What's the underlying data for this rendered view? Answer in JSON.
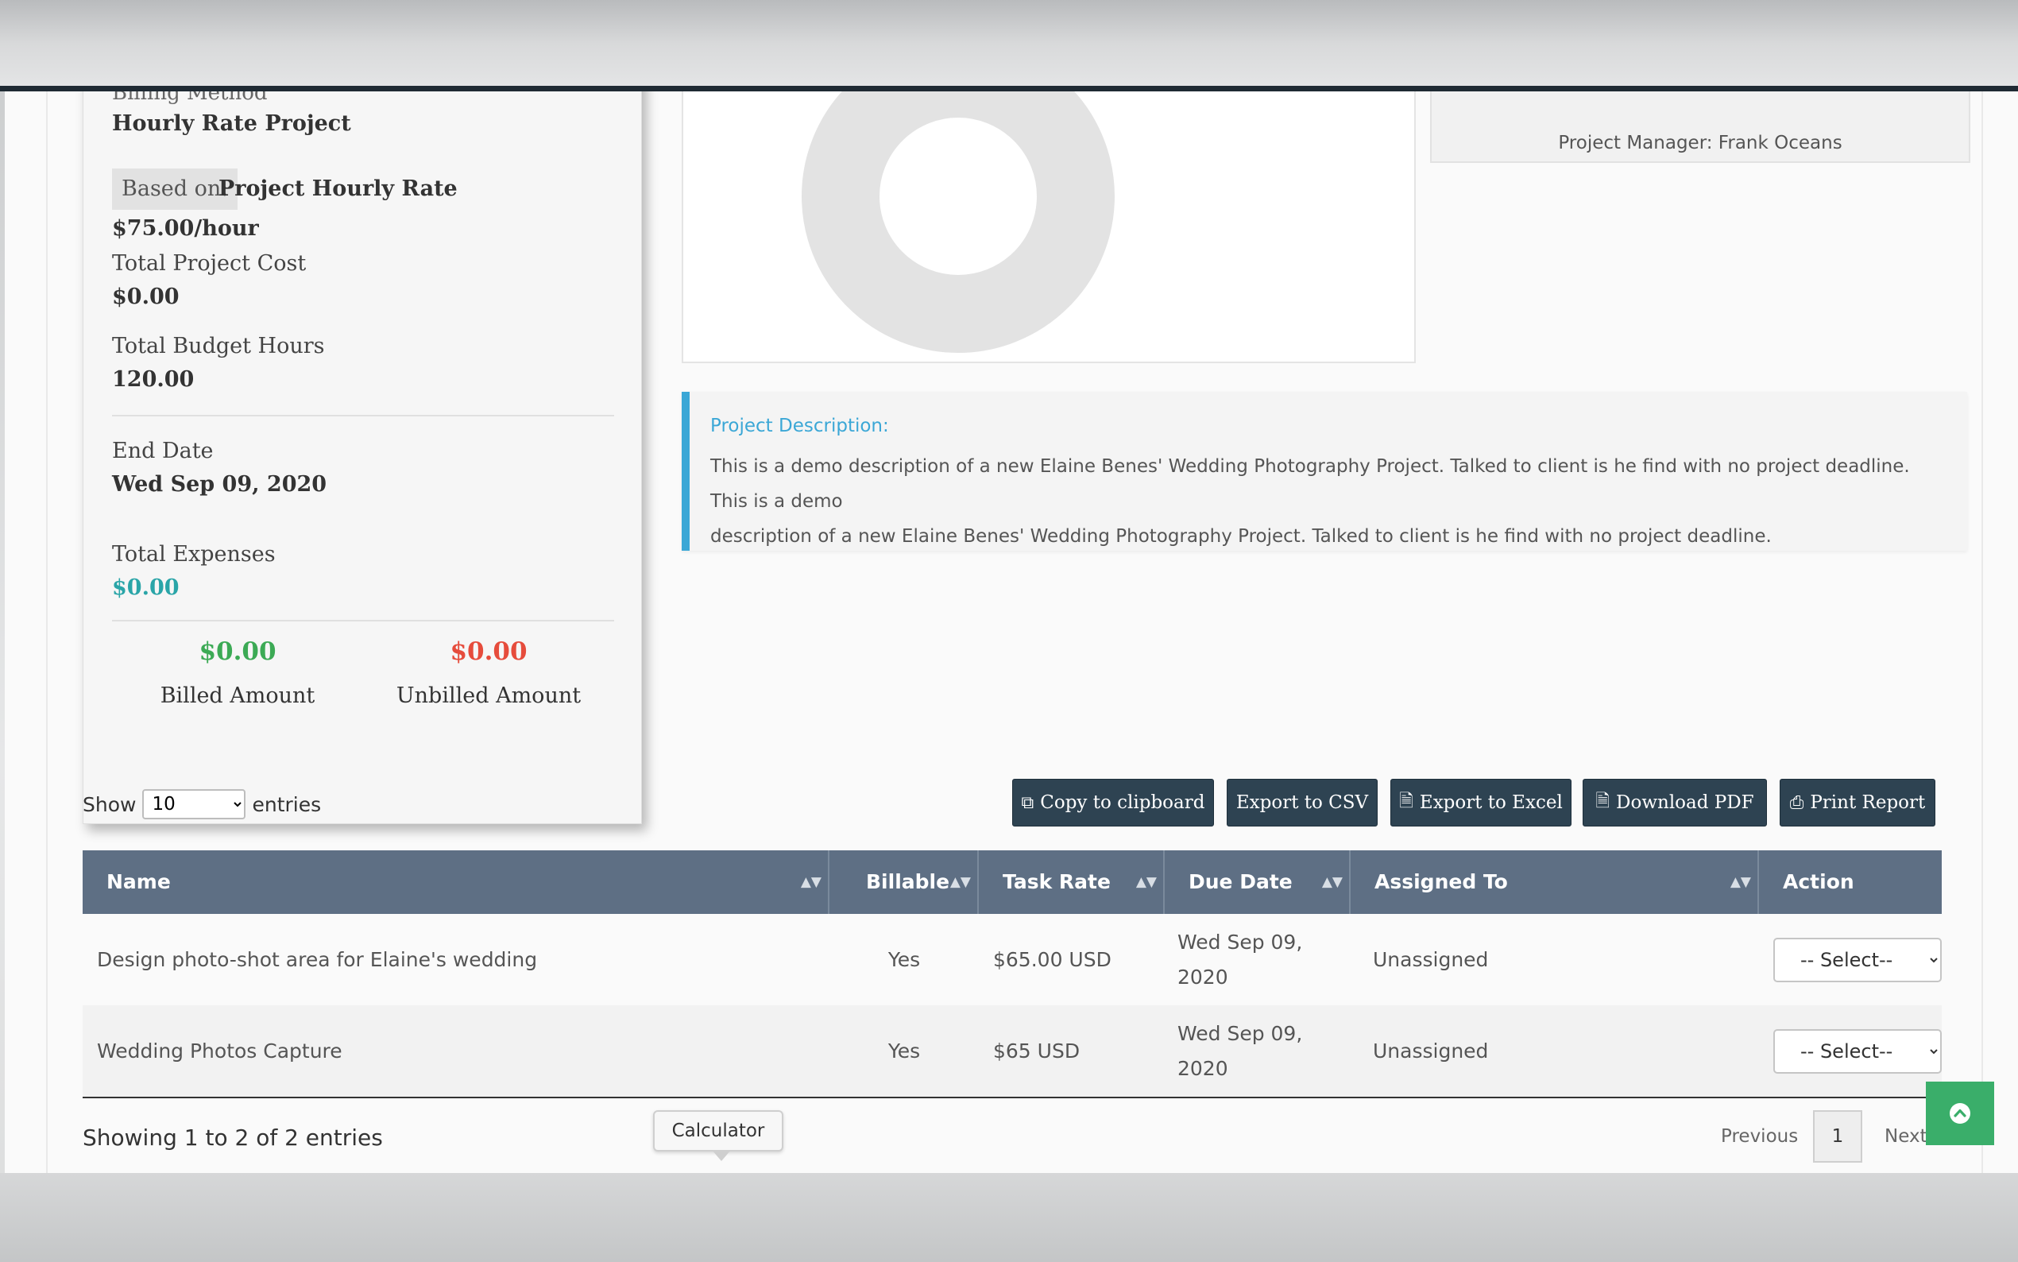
{
  "card": {
    "cut_label": "Billing Method",
    "billing_type": "Hourly Rate Project",
    "based_on_label": "Based on:",
    "based_on_value": "Project Hourly Rate",
    "rate": "$75.00/hour",
    "total_cost_label": "Total Project Cost",
    "total_cost_value": "$0.00",
    "budget_hours_label": "Total Budget Hours",
    "budget_hours_value": "120.00",
    "end_date_label": "End Date",
    "end_date_value": "Wed Sep 09, 2020",
    "expenses_label": "Total Expenses",
    "expenses_value": "$0.00",
    "billed_value": "$0.00",
    "billed_label": "Billed Amount",
    "unbilled_value": "$0.00",
    "unbilled_label": "Unbilled Amount"
  },
  "project_manager": "Project Manager: Frank Oceans",
  "description": {
    "title": "Project Description:",
    "line1": "This is a demo description of a new Elaine Benes' Wedding Photography Project. Talked to client is he find with no project deadline. This is a demo",
    "line2": "description of a new Elaine Benes' Wedding Photography Project. Talked to client is he find with no project deadline."
  },
  "controls": {
    "show_label": "Show",
    "entries_value": "10",
    "entries_label": "entries",
    "copy_btn": "Copy to clipboard",
    "csv_btn": "Export to CSV",
    "excel_btn": "Export to Excel",
    "pdf_btn": "Download PDF",
    "print_btn": "Print Report"
  },
  "table": {
    "headers": {
      "name": "Name",
      "billable": "Billable",
      "task_rate": "Task Rate",
      "due_date": "Due Date",
      "assigned_to": "Assigned To",
      "action": "Action"
    },
    "rows": [
      {
        "name": "Design photo-shot area for Elaine's wedding",
        "billable": "Yes",
        "task_rate": "$65.00 USD",
        "due_line1": "Wed Sep 09,",
        "due_line2": "2020",
        "assigned": "Unassigned",
        "action": "-- Select--"
      },
      {
        "name": "Wedding Photos Capture",
        "billable": "Yes",
        "task_rate": "$65 USD",
        "due_line1": "Wed Sep 09,",
        "due_line2": "2020",
        "assigned": "Unassigned",
        "action": "-- Select--"
      }
    ]
  },
  "footer": {
    "showing": "Showing 1 to 2 of 2 entries",
    "tooltip": "Calculator",
    "previous": "Previous",
    "page": "1",
    "next": "Next"
  },
  "colors": {
    "header_bg": "#5e6f84",
    "button_bg": "#2e4352",
    "accent_blue": "#3ba7d6",
    "billed_green": "#3caa55",
    "unbilled_red": "#e64c3c",
    "expenses_teal": "#2aa5a8",
    "scroll_top_green": "#3aae6a"
  },
  "icons": {
    "copy": "copy-icon",
    "excel": "file-excel-icon",
    "pdf": "file-pdf-icon",
    "print": "print-icon",
    "sort": "sort-icon",
    "scroll_top": "chevron-up-circle-icon"
  }
}
